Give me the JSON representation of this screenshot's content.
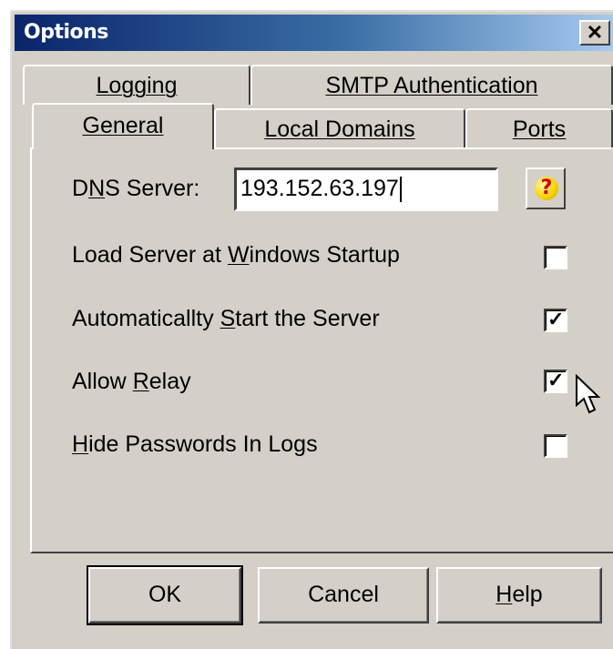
{
  "window": {
    "title": "Options",
    "close_glyph": "✕"
  },
  "tabs": {
    "row1": [
      {
        "prefix": "L",
        "accel": "o",
        "rest": "gging"
      },
      {
        "prefix": "",
        "accel": "S",
        "rest": "MTP Authentication"
      }
    ],
    "row2": [
      {
        "prefix": "",
        "accel": "G",
        "rest": "eneral",
        "active": true
      },
      {
        "prefix": "",
        "accel": "L",
        "rest": "ocal Domains"
      },
      {
        "prefix": "",
        "accel": "P",
        "rest": "orts"
      }
    ]
  },
  "general": {
    "dns": {
      "pre": "D",
      "accel": "N",
      "post": "S Server:",
      "value": "193.152.63.197"
    },
    "help_icon": "question-icon",
    "help_glyph": "?",
    "options": [
      {
        "pre": "Load Server at ",
        "accel": "W",
        "post": "indows Startup",
        "checked": false
      },
      {
        "pre": "Automaticallty ",
        "accel": "S",
        "post": "tart the Server",
        "checked": true
      },
      {
        "pre": "Allow ",
        "accel": "R",
        "post": "elay",
        "checked": true
      },
      {
        "pre": "",
        "accel": "H",
        "post": "ide Passwords In Logs",
        "checked": false
      }
    ],
    "check_glyph": "✓"
  },
  "buttons": {
    "ok": "OK",
    "cancel": "Cancel",
    "help": {
      "accel": "H",
      "rest": "elp"
    }
  },
  "colors": {
    "face": "#d4d0c8",
    "title_start": "#0a246a",
    "title_end": "#a6caf0"
  }
}
